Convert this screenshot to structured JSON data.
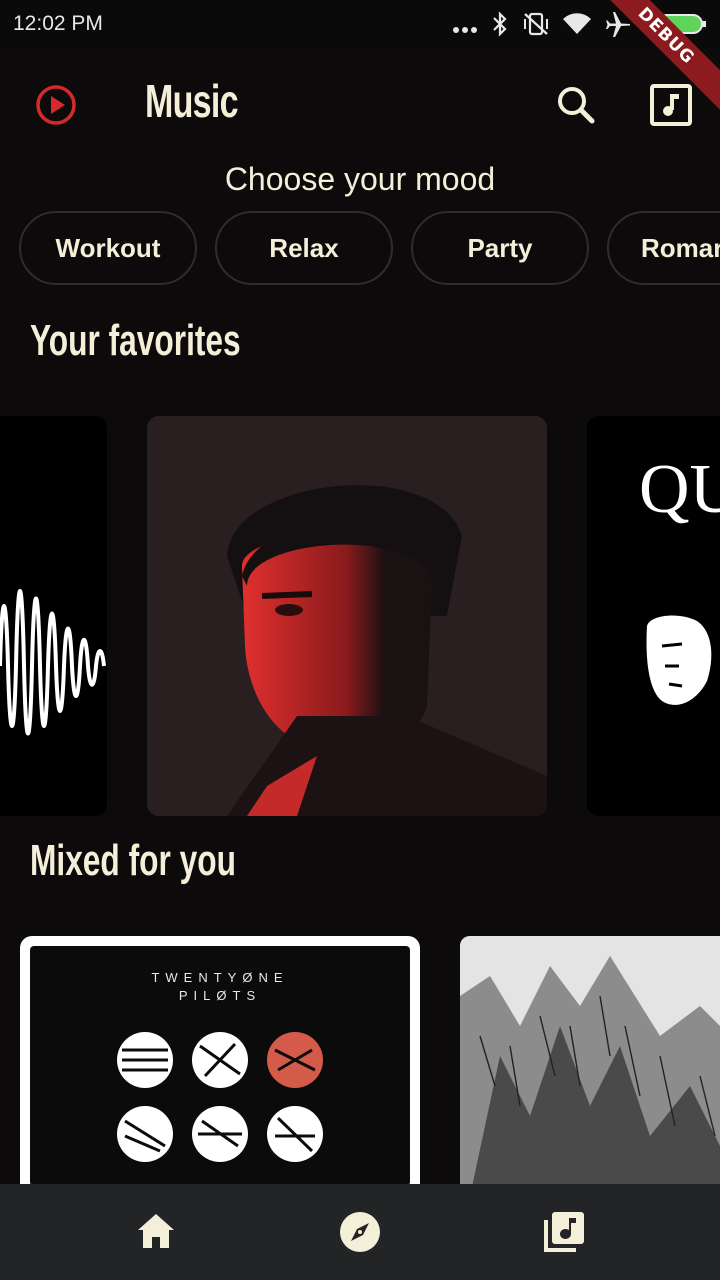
{
  "status_bar": {
    "time": "12:02 PM",
    "debug_label": "DEBUG"
  },
  "app_bar": {
    "title": "Music",
    "logo_icon": "play-circle-icon",
    "actions": [
      "search-icon",
      "music-library-icon"
    ]
  },
  "mood": {
    "heading": "Choose your mood",
    "chips": [
      "Workout",
      "Relax",
      "Party",
      "Romance"
    ],
    "visible_chip_text": [
      "Workout",
      "Relax",
      "Party",
      "Romar"
    ]
  },
  "favorites": {
    "title": "Your favorites",
    "right_card_text": "QU"
  },
  "mixed": {
    "title": "Mixed for you",
    "album_text_line1": "TWENTYØNE",
    "album_text_line2": "PILØTS"
  },
  "bottom_nav": {
    "items": [
      "home-icon",
      "explore-icon",
      "library-music-icon"
    ]
  },
  "colors": {
    "background": "#0c0a0b",
    "accent": "#d42a2a",
    "text": "#f4efd9",
    "nav_background": "#222426"
  }
}
